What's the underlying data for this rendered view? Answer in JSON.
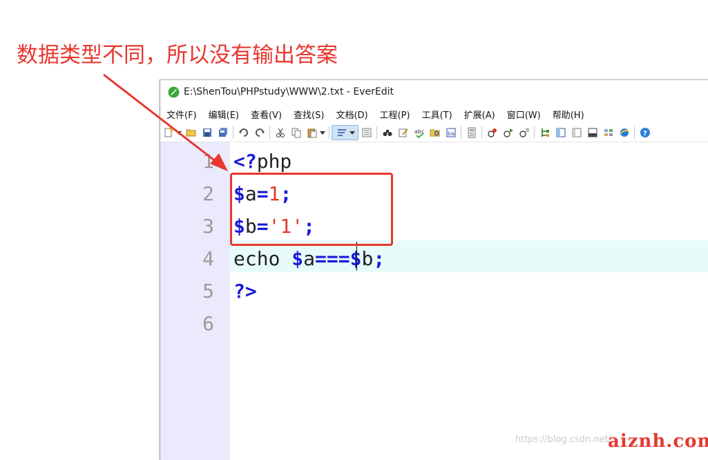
{
  "annotation": {
    "text": "数据类型不同，所以没有输出答案",
    "color": "#e8372f"
  },
  "window": {
    "title": "E:\\ShenTou\\PHPstudy\\WWW\\2.txt - EverEdit",
    "app_icon": "everedit-logo-icon"
  },
  "menu": [
    {
      "label": "文件(F)"
    },
    {
      "label": "编辑(E)"
    },
    {
      "label": "查看(V)"
    },
    {
      "label": "查找(S)"
    },
    {
      "label": "文档(D)"
    },
    {
      "label": "工程(P)"
    },
    {
      "label": "工具(T)"
    },
    {
      "label": "扩展(A)"
    },
    {
      "label": "窗口(W)"
    },
    {
      "label": "帮助(H)"
    }
  ],
  "toolbar_icons": [
    "new-file-icon",
    "open-folder-icon",
    "save-icon",
    "save-all-icon",
    "undo-icon",
    "redo-icon",
    "cut-icon",
    "copy-icon",
    "paste-icon",
    "word-wrap-icon",
    "column-mode-icon",
    "find-icon",
    "edit-icon",
    "spell-check-icon",
    "find-in-files-icon",
    "replace-icon",
    "calculator-icon",
    "record-macro-icon",
    "play-macro-icon",
    "run-macro-icon",
    "tree-icon",
    "split-view-icon",
    "panel-icon",
    "output-icon",
    "plugin-icon",
    "browser-icon",
    "help-icon"
  ],
  "editor": {
    "lines": [
      {
        "number": "1"
      },
      {
        "number": "2"
      },
      {
        "number": "3"
      },
      {
        "number": "4"
      },
      {
        "number": "5"
      },
      {
        "number": "6"
      }
    ],
    "code": {
      "line1_open": "<?",
      "line1_php": "php",
      "line2_dollar": "$",
      "line2_var": "a",
      "line2_eq": "=",
      "line2_num": "1",
      "line2_semi": ";",
      "line3_dollar": "$",
      "line3_var": "b",
      "line3_eq": "=",
      "line3_str": "'1'",
      "line3_semi": ";",
      "line4_echo": "echo ",
      "line4_dollar1": "$",
      "line4_var1": "a",
      "line4_op": "===",
      "line4_dollar2": "$",
      "line4_var2": "b",
      "line4_semi": ";",
      "line5_close": "?>"
    },
    "current_line": 4
  },
  "watermark": {
    "url": "https://blog.csdn.net/...",
    "logo": "aiznh.com"
  },
  "colors": {
    "gutter_bg": "#eaeafc",
    "current_line_bg": "#e8fbfb",
    "keyword": "#1a1ad6",
    "string": "#e03a2e",
    "annotation_red": "#e8372f"
  }
}
